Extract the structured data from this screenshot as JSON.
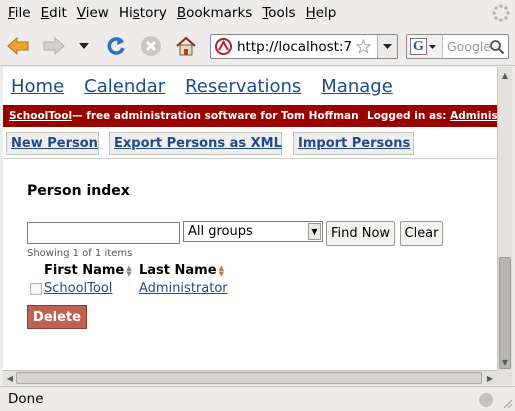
{
  "menubar": {
    "items": [
      {
        "accel": "F",
        "rest": "ile"
      },
      {
        "accel": "E",
        "rest": "dit"
      },
      {
        "accel": "V",
        "rest": "iew"
      },
      {
        "pre": "Hi",
        "accel": "s",
        "rest": "tory"
      },
      {
        "accel": "B",
        "rest": "ookmarks"
      },
      {
        "accel": "T",
        "rest": "ools"
      },
      {
        "accel": "H",
        "rest": "elp"
      }
    ]
  },
  "toolbar": {
    "url": "http://localhost:7",
    "search_placeholder": "Google",
    "icons": [
      "back-arrow-icon",
      "forward-arrow-icon",
      "history-dropdown-icon",
      "reload-icon",
      "stop-icon",
      "home-icon",
      "site-favicon",
      "bookmark-star-icon",
      "url-dropdown-icon",
      "google-logo-icon",
      "search-magnifier-icon"
    ]
  },
  "site_nav": {
    "items": [
      "Home",
      "Calendar",
      "Reservations",
      "Manage"
    ]
  },
  "banner": {
    "brand": "SchoolTool",
    "tagline": " — free administration software for Tom Hoffman",
    "login_label": "Logged in as: ",
    "login_user": "Administrator"
  },
  "actions": {
    "new_person": "New Person",
    "export_xml": "Export Persons as XML",
    "import_persons": "Import Persons"
  },
  "person_index": {
    "title": "Person index",
    "search_value": "",
    "group_selected": "All groups",
    "find_now": "Find Now",
    "clear": "Clear",
    "showing": "Showing 1 of 1 items",
    "columns": [
      "First Name",
      "Last Name"
    ],
    "rows": [
      {
        "first_name": "SchoolTool",
        "last_name": "Administrator",
        "checked": false
      }
    ],
    "delete": "Delete"
  },
  "statusbar": {
    "text": "Done"
  },
  "colors": {
    "banner_bg": "#990000",
    "link": "#1f4a8c",
    "delete_bg": "#c06155"
  }
}
